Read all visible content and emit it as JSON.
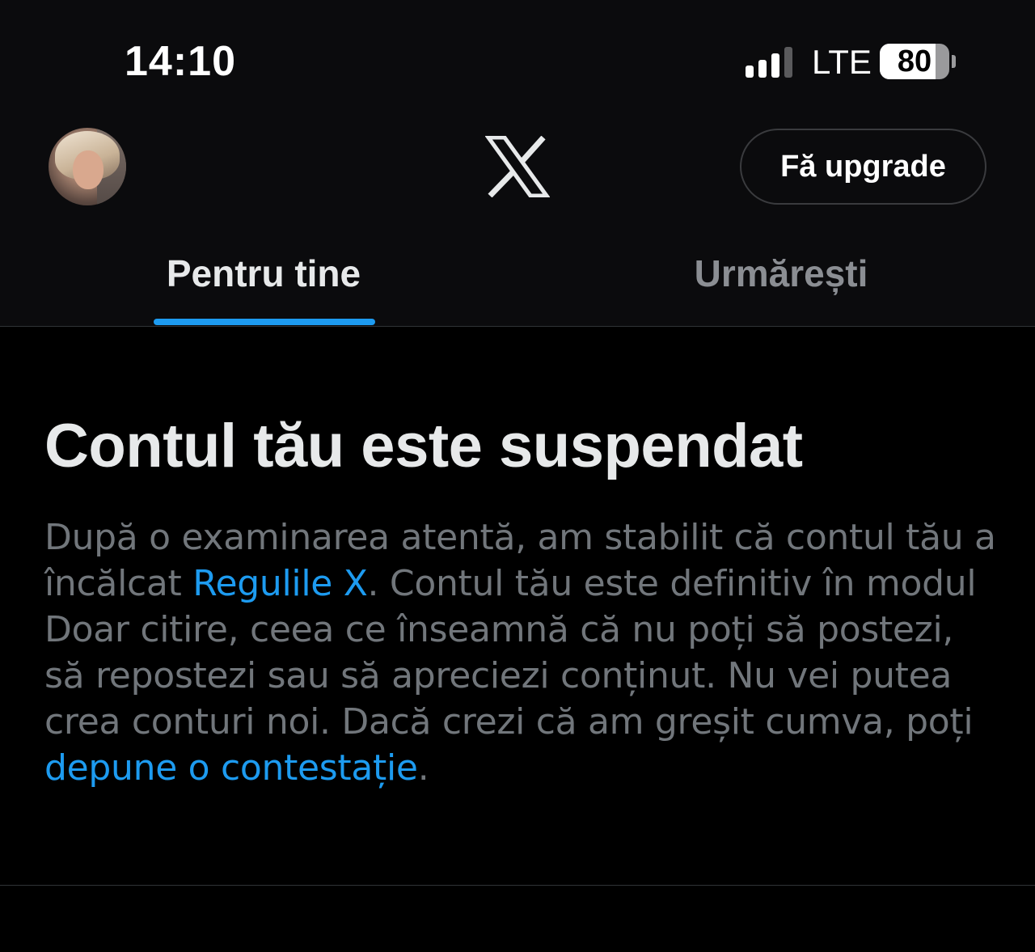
{
  "status_bar": {
    "time": "14:10",
    "network": "LTE",
    "battery_level": "80",
    "battery_fraction": 0.8,
    "signal_bars_filled": 3,
    "signal_bars_total": 4
  },
  "header": {
    "logo_icon": "x-logo-icon",
    "upgrade_label": "Fă upgrade"
  },
  "tabs": [
    {
      "label": "Pentru tine",
      "active": true
    },
    {
      "label": "Urmărești",
      "active": false
    }
  ],
  "notice": {
    "title": "Contul tău este suspendat",
    "body_1": "După o examinarea atentă, am stabilit că contul tău a încălcat ",
    "rules_link": "Regulile X",
    "body_2": ". Contul tău este definitiv în modul Doar citire, ceea ce înseamnă că nu poți să postezi, să repostezi sau să apreciezi conținut. Nu vei putea crea conturi noi. Dacă crezi că am greșit cumva, poți ",
    "appeal_link": "depune o contestație",
    "body_3": "."
  },
  "colors": {
    "accent": "#1d9bf0",
    "background": "#000000",
    "secondary_text": "#71767b"
  }
}
